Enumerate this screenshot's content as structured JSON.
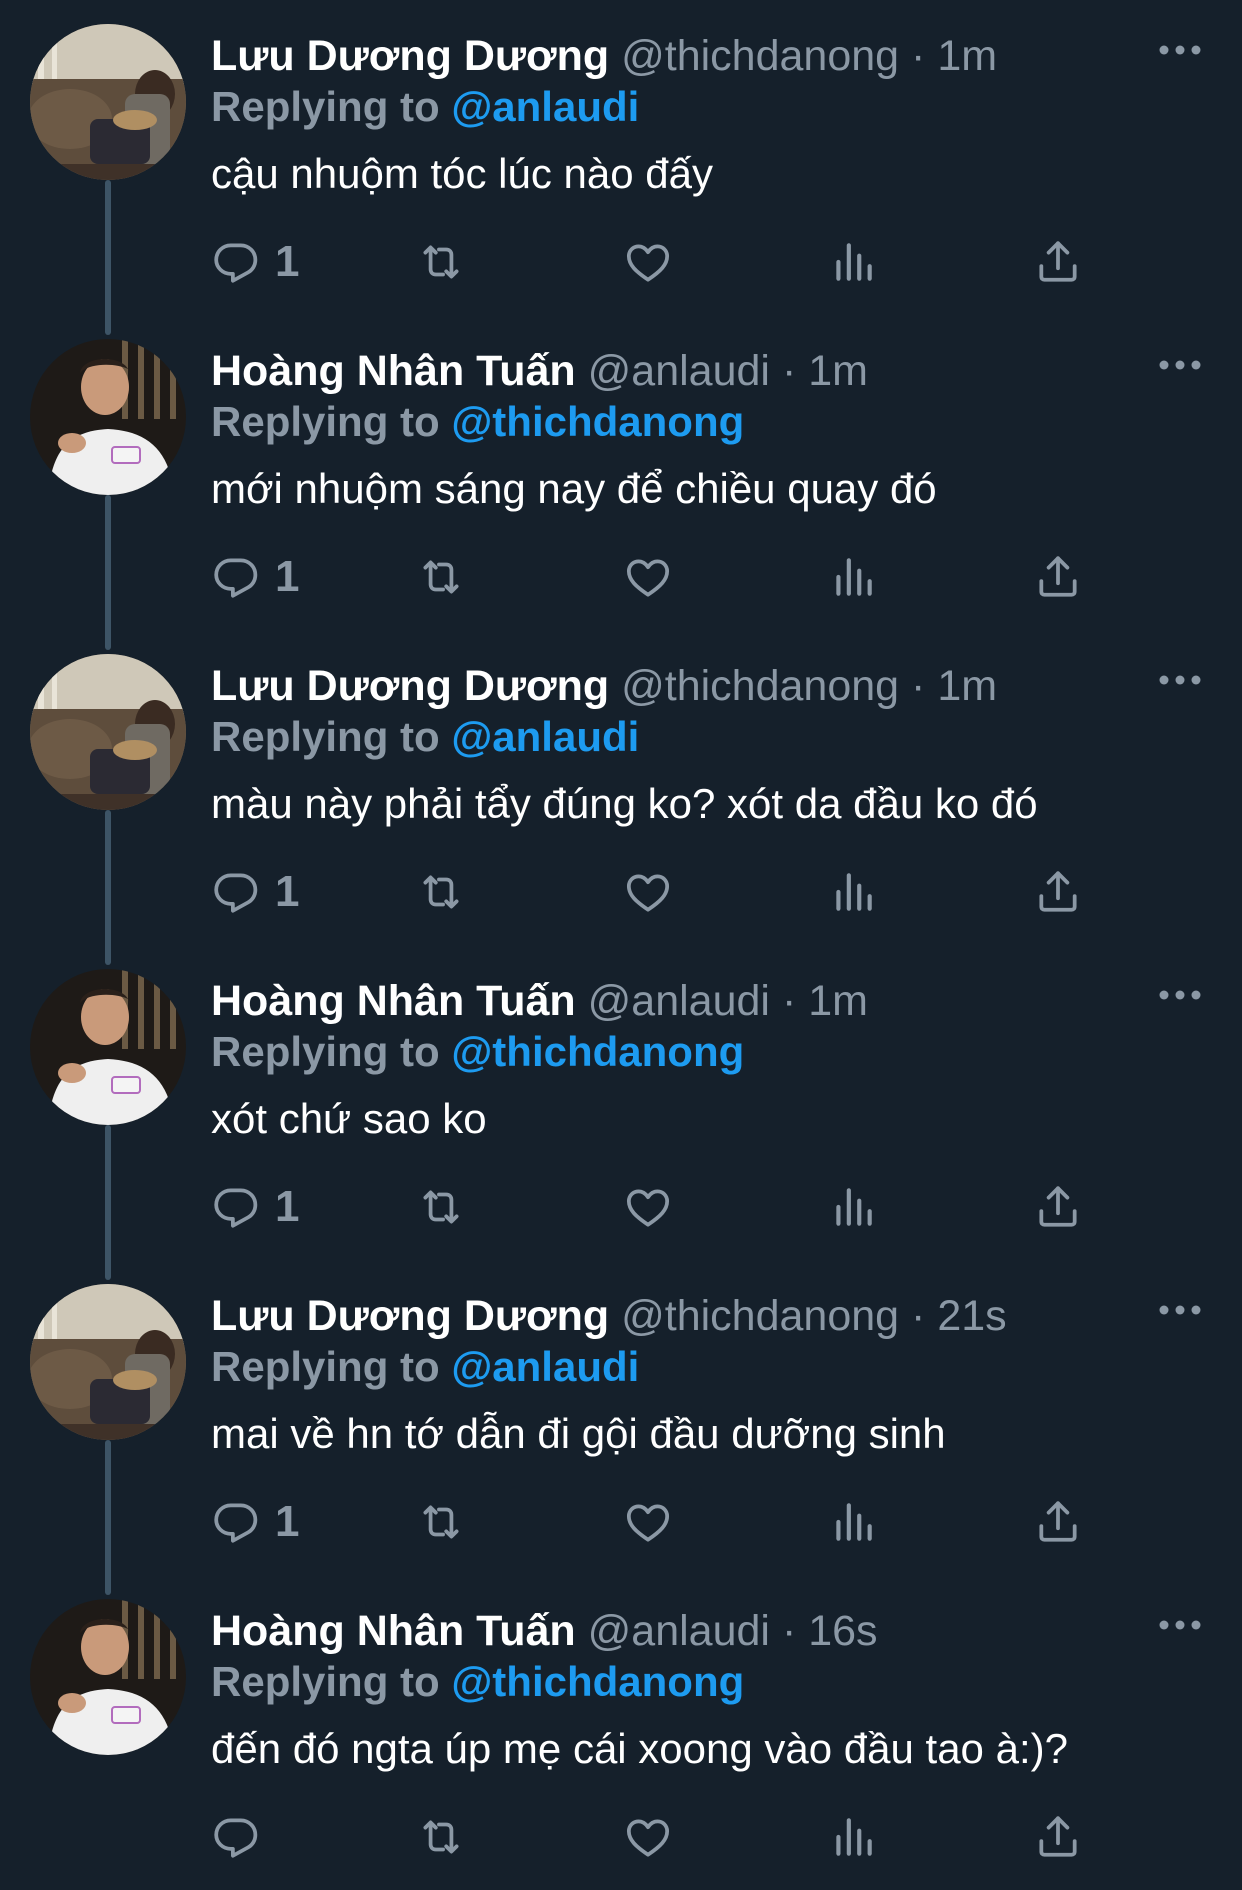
{
  "colors": {
    "background": "#15202b",
    "text": "#ffffff",
    "secondary": "#8b98a5",
    "mention": "#1d9bf0",
    "thread_line": "#3d5466"
  },
  "icons": {
    "more": "more-horizontal-icon",
    "reply": "reply-icon",
    "retweet": "retweet-icon",
    "like": "like-icon",
    "views": "views-icon",
    "share": "share-icon"
  },
  "tweets": [
    {
      "name": "Lưu Dương Dương",
      "handle": "@thichdanong",
      "dot": "·",
      "time": "1m",
      "replying_prefix": "Replying to",
      "mention": "@anlaudi",
      "text": "cậu nhuộm tóc lúc nào đấy",
      "reply_count": "1",
      "avatar": "avatar-luu-duong-duong"
    },
    {
      "name": "Hoàng Nhân Tuấn",
      "handle": "@anlaudi",
      "dot": "·",
      "time": "1m",
      "replying_prefix": "Replying to",
      "mention": "@thichdanong",
      "text": "mới nhuộm sáng nay để chiều quay đó",
      "reply_count": "1",
      "avatar": "avatar-hoang-nhan-tuan"
    },
    {
      "name": "Lưu Dương Dương",
      "handle": "@thichdanong",
      "dot": "·",
      "time": "1m",
      "replying_prefix": "Replying to",
      "mention": "@anlaudi",
      "text": "màu này phải tẩy đúng ko? xót da đầu ko đó",
      "reply_count": "1",
      "avatar": "avatar-luu-duong-duong"
    },
    {
      "name": "Hoàng Nhân Tuấn",
      "handle": "@anlaudi",
      "dot": "·",
      "time": "1m",
      "replying_prefix": "Replying to",
      "mention": "@thichdanong",
      "text": "xót chứ sao ko",
      "reply_count": "1",
      "avatar": "avatar-hoang-nhan-tuan"
    },
    {
      "name": "Lưu Dương Dương",
      "handle": "@thichdanong",
      "dot": "·",
      "time": "21s",
      "replying_prefix": "Replying to",
      "mention": "@anlaudi",
      "text": "mai về hn tớ dẫn đi gội đầu dưỡng sinh",
      "reply_count": "1",
      "avatar": "avatar-luu-duong-duong"
    },
    {
      "name": "Hoàng Nhân Tuấn",
      "handle": "@anlaudi",
      "dot": "·",
      "time": "16s",
      "replying_prefix": "Replying to",
      "mention": "@thichdanong",
      "text": "đến đó ngta úp mẹ cái xoong vào đầu tao à:)?",
      "reply_count": "",
      "avatar": "avatar-hoang-nhan-tuan"
    }
  ]
}
